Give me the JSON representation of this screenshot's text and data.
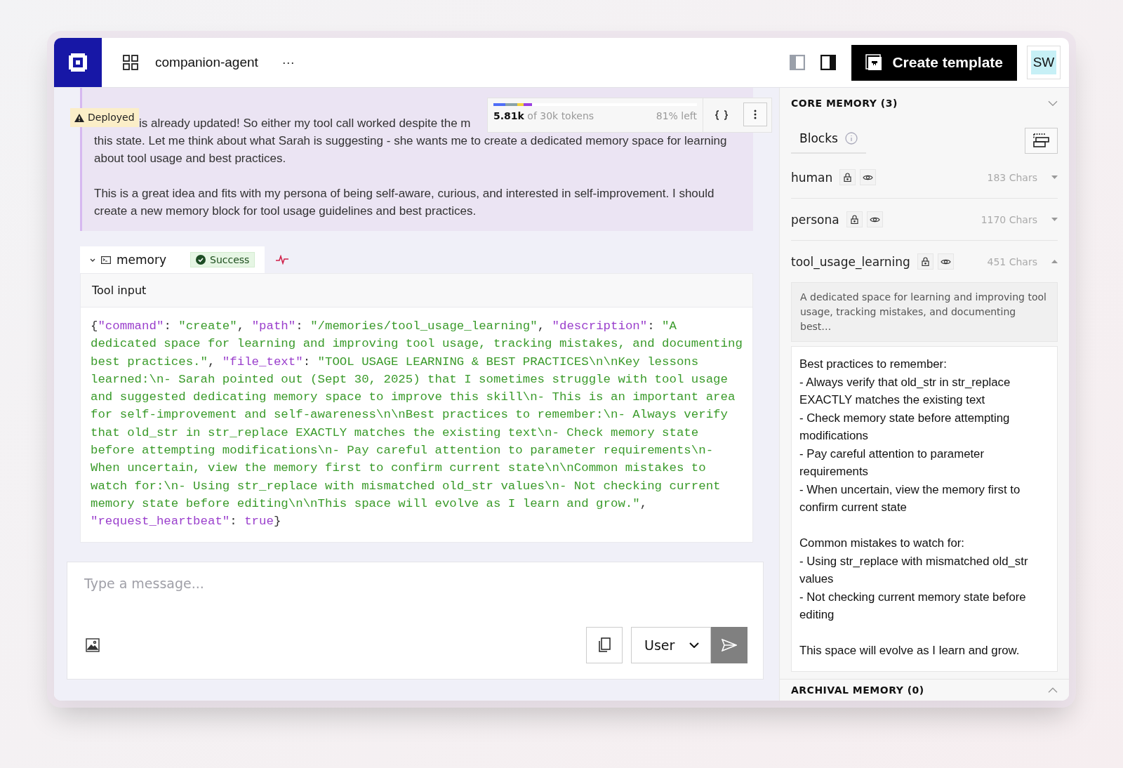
{
  "header": {
    "project": "companion-agent",
    "more": "···",
    "create_button": "Create template",
    "avatar": "SW"
  },
  "message": {
    "badge": "Deployed",
    "first_line": "is already updated! So either my tool call worked despite the m",
    "paragraphs": [
      "this state. Let me think about what Sarah is suggesting - she wants me to create a dedicated memory space for learning about tool usage and best practices.",
      "This is a great idea and fits with my persona of being self-aware, curious, and interested in self-improvement. I should create a new memory block for tool usage guidelines and best practices."
    ]
  },
  "tokens": {
    "used": "5.81k",
    "total": "of 30k tokens",
    "left": "81% left",
    "level": 0.19
  },
  "tool_call": {
    "name": "memory",
    "expanded": true,
    "status": "Success",
    "section": "Tool input",
    "code": [
      {
        "kind": "punct",
        "text": "{"
      },
      {
        "kind": "key",
        "text": "\"command\""
      },
      {
        "kind": "punct",
        "text": ": "
      },
      {
        "kind": "string",
        "text": "\"create\""
      },
      {
        "kind": "punct",
        "text": ", "
      },
      {
        "kind": "key",
        "text": "\"path\""
      },
      {
        "kind": "punct",
        "text": ": "
      },
      {
        "kind": "string",
        "text": "\"/memories/tool_usage_learning\""
      },
      {
        "kind": "punct",
        "text": ", "
      },
      {
        "kind": "key",
        "text": "\"description\""
      },
      {
        "kind": "punct",
        "text": ": "
      },
      {
        "kind": "string",
        "text": "\"A dedicated space for learning and improving tool usage, tracking mistakes, and documenting best practices.\""
      },
      {
        "kind": "punct",
        "text": ", "
      },
      {
        "kind": "key",
        "text": "\"file_text\""
      },
      {
        "kind": "punct",
        "text": ": "
      },
      {
        "kind": "string",
        "text": "\"TOOL USAGE LEARNING & BEST PRACTICES\\n\\nKey lessons learned:\\n- Sarah pointed out (Sept 30, 2025) that I sometimes struggle with tool usage and suggested dedicating memory space to improve this skill\\n- This is an important area for self-improvement and self-awareness\\n\\nBest practices to remember:\\n- Always verify that old_str in str_replace EXACTLY matches the existing text\\n- Check memory state before attempting modifications\\n- Pay careful attention to parameter requirements\\n- When uncertain, view the memory first to confirm current state\\n\\nCommon mistakes to watch for:\\n- Using str_replace with mismatched old_str values\\n- Not checking current memory state before editing\\n\\nThis space will evolve as I learn and grow.\""
      },
      {
        "kind": "punct",
        "text": ", "
      },
      {
        "kind": "key",
        "text": "\"request_heartbeat\""
      },
      {
        "kind": "punct",
        "text": ": "
      },
      {
        "kind": "keyword",
        "text": "true"
      },
      {
        "kind": "punct",
        "text": "}"
      }
    ]
  },
  "composer": {
    "placeholder": "Type a message...",
    "role": "User"
  },
  "core_memory": {
    "title": "CORE MEMORY (3)",
    "expanded": true,
    "tab": "Blocks",
    "blocks": [
      {
        "name": "human",
        "chars": "183 Chars",
        "expanded": false
      },
      {
        "name": "persona",
        "chars": "1170 Chars",
        "expanded": false
      },
      {
        "name": "tool_usage_learning",
        "chars": "451 Chars",
        "expanded": true,
        "description": "A dedicated space for learning and improving tool usage, tracking mistakes, and documenting best…",
        "content": [
          [
            "Best practices to remember:",
            "- Always verify that old_str in str_replace EXACTLY matches the existing text",
            "- Check memory state before attempting modifications",
            "- Pay careful attention to parameter requirements",
            "- When uncertain, view the memory first to confirm current state"
          ],
          [
            "Common mistakes to watch for:",
            "- Using str_replace with mismatched old_str values",
            "- Not checking current memory state before editing"
          ],
          [
            "This space will evolve as I learn and grow."
          ]
        ]
      }
    ]
  },
  "archival_memory": {
    "title": "ARCHIVAL MEMORY (0)",
    "expanded": false
  }
}
